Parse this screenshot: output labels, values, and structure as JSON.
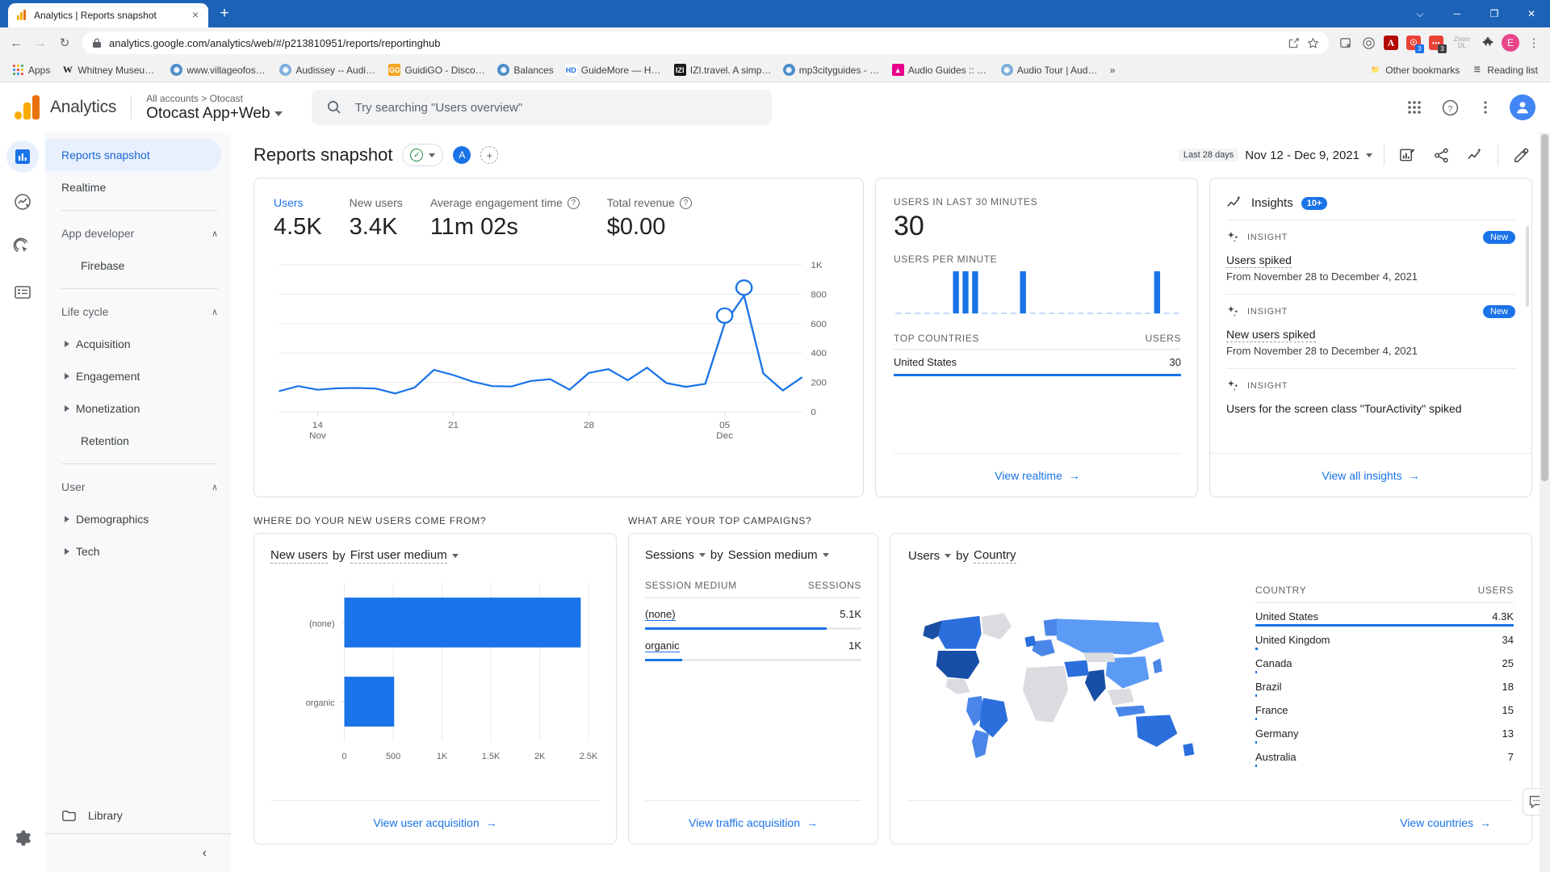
{
  "browser": {
    "tab": {
      "title": "Analytics | Reports snapshot",
      "favicon": "analytics-icon",
      "close": "×"
    },
    "new_tab": "+",
    "window_controls": [
      "⌵",
      "─",
      "❐",
      "✕"
    ],
    "nav": {
      "back": "←",
      "forward": "→",
      "reload": "↻"
    },
    "omnibox": {
      "lock": "lock-icon",
      "url": "analytics.google.com/analytics/web/#/p213810951/reports/reportinghub",
      "share": "share-icon",
      "star": "star-icon"
    },
    "extensions": [
      {
        "name": "tab-mute-extension",
        "glyph": "▤",
        "color": "#5f6368",
        "badge": ""
      },
      {
        "name": "target-extension",
        "glyph": "◎",
        "color": "#5f6368",
        "badge": ""
      },
      {
        "name": "adobe-acrobat-extension",
        "glyph": "A",
        "color": "#b30b00",
        "badge": ""
      },
      {
        "name": "clipper-extension",
        "glyph": "⌘",
        "color": "#ea4335",
        "badge": "3",
        "badge_color": "#1a73e8"
      },
      {
        "name": "recorder-extension",
        "glyph": "•••",
        "color": "#ea4335",
        "badge": "3",
        "badge_color": "#3c4043"
      },
      {
        "name": "zoom-dl-extension",
        "glyph": "Zoom DL",
        "color": "",
        "badge": ""
      },
      {
        "name": "puzzle-extensions-menu",
        "glyph": "🧩",
        "color": "#3c4043",
        "badge": ""
      }
    ],
    "profile_initial": "E",
    "menu": "⋮",
    "bookmarks": [
      {
        "label": "Apps",
        "icon": "apps-grid-icon",
        "color": ""
      },
      {
        "label": "Whitney Museum o...",
        "icon": "w-icon",
        "color": "#ffffff"
      },
      {
        "label": "www.villageofossini...",
        "icon": "globe-icon",
        "color": "#4d8ec9"
      },
      {
        "label": "Audissey -- Audio T...",
        "icon": "globe-icon",
        "color": "#6ea8d8"
      },
      {
        "label": "GuidiGO - Discover...",
        "icon": "guidigo-icon",
        "color": "#f5a623"
      },
      {
        "label": "Balances",
        "icon": "globe-icon",
        "color": "#4d8ec9"
      },
      {
        "label": "GuideMore — Home",
        "icon": "hd-icon",
        "color": "#1a73e8"
      },
      {
        "label": "IZI.travel. A simple...",
        "icon": "izi-icon",
        "color": "#1a1a1a"
      },
      {
        "label": "mp3cityguides - Do...",
        "icon": "globe-icon",
        "color": "#4d8ec9"
      },
      {
        "label": "Audio Guides :: Ne...",
        "icon": "pink-icon",
        "color": "#e8008c"
      },
      {
        "label": "Audio Tour | Audio...",
        "icon": "globe-icon",
        "color": "#6ea8d8"
      }
    ],
    "overflow": "»",
    "other_bookmarks": "Other bookmarks",
    "reading_list": "Reading list"
  },
  "ga_header": {
    "brand": "Analytics",
    "breadcrumb": "All accounts > Otocast",
    "property": "Otocast App+Web",
    "search_placeholder": "Try searching \"Users overview\"",
    "icons": [
      "apps-icon",
      "help-icon",
      "more-vert-icon",
      "account-avatar"
    ]
  },
  "rail": [
    {
      "name": "reports-icon",
      "glyph": "▤",
      "active": true
    },
    {
      "name": "explore-icon",
      "glyph": "↗",
      "active": false
    },
    {
      "name": "advertising-icon",
      "glyph": "◎",
      "active": false
    },
    {
      "name": "configure-icon",
      "glyph": "≡",
      "active": false
    },
    {
      "name": "admin-gear-icon",
      "glyph": "⚙",
      "active": false
    }
  ],
  "sidebar": {
    "items": [
      {
        "label": "Reports snapshot",
        "type": "item",
        "active": true
      },
      {
        "label": "Realtime",
        "type": "item",
        "active": false
      }
    ],
    "groups": [
      {
        "label": "App developer",
        "collapse": "∧",
        "children": [
          {
            "label": "Firebase",
            "expandable": false
          }
        ]
      },
      {
        "label": "Life cycle",
        "collapse": "∧",
        "children": [
          {
            "label": "Acquisition",
            "expandable": true
          },
          {
            "label": "Engagement",
            "expandable": true
          },
          {
            "label": "Monetization",
            "expandable": true
          },
          {
            "label": "Retention",
            "expandable": false
          }
        ]
      },
      {
        "label": "User",
        "collapse": "∧",
        "children": [
          {
            "label": "Demographics",
            "expandable": true
          },
          {
            "label": "Tech",
            "expandable": true
          }
        ]
      }
    ],
    "library": {
      "label": "Library",
      "icon": "folder-icon"
    },
    "collapse": "‹"
  },
  "page": {
    "title": "Reports snapshot",
    "status_chip": "✓",
    "audience_pill": "A",
    "add_comparison": "+",
    "date": {
      "tag": "Last 28 days",
      "range": "Nov 12 - Dec 9, 2021"
    },
    "actions": [
      "insights-report-icon",
      "share-icon",
      "compare-icon",
      "edit-pencil-icon"
    ],
    "feedback_icon": "feedback-icon"
  },
  "overview_card": {
    "metrics": [
      {
        "label": "Users",
        "value": "4.5K",
        "help": false,
        "highlight": true
      },
      {
        "label": "New users",
        "value": "3.4K",
        "help": false,
        "highlight": false
      },
      {
        "label": "Average engagement time",
        "value": "11m 02s",
        "help": true,
        "highlight": false
      },
      {
        "label": "Total revenue",
        "value": "$0.00",
        "help": true,
        "highlight": false
      }
    ]
  },
  "realtime_card": {
    "users_label": "USERS IN LAST 30 MINUTES",
    "users_value": "30",
    "per_minute_label": "USERS PER MINUTE",
    "table_head": {
      "dimension": "TOP COUNTRIES",
      "metric": "USERS"
    },
    "rows": [
      {
        "country": "United States",
        "users": "30",
        "pct": 100
      }
    ],
    "footer_link": "View realtime",
    "footer_arrow": "→"
  },
  "insights_card": {
    "title": "Insights",
    "count": "10+",
    "items": [
      {
        "kicker": "INSIGHT",
        "badge": "New",
        "headline": "Users spiked",
        "sub": "From November 28 to December 4, 2021"
      },
      {
        "kicker": "INSIGHT",
        "badge": "New",
        "headline": "New users spiked",
        "sub": "From November 28 to December 4, 2021"
      },
      {
        "kicker": "INSIGHT",
        "badge": "",
        "headline": "Users for the screen class \"TourActivity\" spiked",
        "sub": ""
      }
    ],
    "footer_link": "View all insights",
    "footer_arrow": "→"
  },
  "acquisition_card": {
    "section_title": "WHERE DO YOUR NEW USERS COME FROM?",
    "metric_sel": "New users",
    "by_text": "by",
    "dim_sel": "First user medium",
    "footer_link": "View user acquisition",
    "footer_arrow": "→"
  },
  "campaigns_card": {
    "section_title": "WHAT ARE YOUR TOP CAMPAIGNS?",
    "metric_sel": "Sessions",
    "by_text": "by",
    "dim_sel": "Session medium",
    "head": {
      "dimension": "SESSION MEDIUM",
      "metric": "SESSIONS"
    },
    "rows": [
      {
        "medium": "(none)",
        "sessions": "5.1K",
        "pct": 84
      },
      {
        "medium": "organic",
        "sessions": "1K",
        "pct": 17
      }
    ],
    "footer_link": "View traffic acquisition",
    "footer_arrow": "→"
  },
  "countries_card": {
    "metric_sel": "Users",
    "by_text": "by",
    "dim_sel": "Country",
    "head": {
      "dimension": "COUNTRY",
      "metric": "USERS"
    },
    "rows": [
      {
        "country": "United States",
        "users": "4.3K",
        "pct": 100
      },
      {
        "country": "United Kingdom",
        "users": "34",
        "pct": 0.8
      },
      {
        "country": "Canada",
        "users": "25",
        "pct": 0.6
      },
      {
        "country": "Brazil",
        "users": "18",
        "pct": 0.45
      },
      {
        "country": "France",
        "users": "15",
        "pct": 0.38
      },
      {
        "country": "Germany",
        "users": "13",
        "pct": 0.33
      },
      {
        "country": "Australia",
        "users": "7",
        "pct": 0.2
      }
    ],
    "footer_link": "View countries",
    "footer_arrow": "→"
  },
  "chart_data": [
    {
      "type": "line",
      "title": "Users over time",
      "xlabel": "",
      "ylabel": "Users",
      "ylim": [
        0,
        1000
      ],
      "yticks": [
        0,
        200,
        400,
        600,
        800,
        1000
      ],
      "ytick_labels": [
        "0",
        "200",
        "400",
        "600",
        "800",
        "1K"
      ],
      "xticks": [
        "14\nNov",
        "21",
        "28",
        "05\nDec"
      ],
      "xtick_positions": [
        2,
        9,
        16,
        23
      ],
      "grid": true,
      "x": [
        "Nov 12",
        "Nov 13",
        "Nov 14",
        "Nov 15",
        "Nov 16",
        "Nov 17",
        "Nov 18",
        "Nov 19",
        "Nov 20",
        "Nov 21",
        "Nov 22",
        "Nov 23",
        "Nov 24",
        "Nov 25",
        "Nov 26",
        "Nov 27",
        "Nov 28",
        "Nov 29",
        "Nov 30",
        "Dec 1",
        "Dec 2",
        "Dec 3",
        "Dec 4",
        "Dec 5",
        "Dec 6",
        "Dec 7",
        "Dec 8",
        "Dec 9"
      ],
      "values": [
        140,
        175,
        150,
        160,
        162,
        158,
        125,
        165,
        285,
        250,
        205,
        175,
        172,
        210,
        222,
        150,
        265,
        290,
        215,
        300,
        195,
        170,
        190,
        600,
        790,
        260,
        145,
        235
      ],
      "markers": [
        {
          "index": 23,
          "value": 600
        },
        {
          "index": 24,
          "value": 790
        }
      ],
      "color": "#1a73e8"
    },
    {
      "type": "bar",
      "title": "Users per minute",
      "orientation": "vertical",
      "categories": [
        "1",
        "2",
        "3",
        "4",
        "5",
        "6",
        "7",
        "8",
        "9",
        "10",
        "11",
        "12",
        "13",
        "14",
        "15",
        "16",
        "17",
        "18",
        "19",
        "20",
        "21",
        "22",
        "23",
        "24",
        "25",
        "26",
        "27",
        "28",
        "29",
        "30"
      ],
      "values": [
        0,
        0,
        0,
        0,
        0,
        0,
        6,
        6,
        6,
        0,
        0,
        0,
        0,
        6,
        0,
        0,
        0,
        0,
        0,
        0,
        0,
        0,
        0,
        0,
        0,
        0,
        0,
        6,
        0,
        0
      ],
      "color": "#1a73e8",
      "ylim": [
        0,
        8
      ]
    },
    {
      "type": "bar",
      "title": "New users by First user medium",
      "orientation": "horizontal",
      "categories": [
        "(none)",
        "organic"
      ],
      "values": [
        2420,
        510
      ],
      "xticks": [
        0,
        500,
        1000,
        1500,
        2000,
        2500
      ],
      "xtick_labels": [
        "0",
        "500",
        "1K",
        "1.5K",
        "2K",
        "2.5K"
      ],
      "xlim": [
        0,
        2500
      ],
      "ylabel": "",
      "xlabel": "",
      "color": "#1a73e8",
      "grid": true
    },
    {
      "type": "table",
      "title": "Sessions by Session medium",
      "columns": [
        "SESSION MEDIUM",
        "SESSIONS"
      ],
      "rows": [
        [
          "(none)",
          "5.1K"
        ],
        [
          "organic",
          "1K"
        ]
      ]
    },
    {
      "type": "heatmap",
      "title": "Users by Country (world map)",
      "categories": [
        "United States",
        "United Kingdom",
        "Canada",
        "Brazil",
        "France",
        "Germany",
        "Australia"
      ],
      "values": [
        4300,
        34,
        25,
        18,
        15,
        13,
        7
      ],
      "colors": {
        "max": "#174ea6",
        "mid": "#1a73e8",
        "low": "#5b9bf5",
        "none": "#dadce0"
      }
    }
  ]
}
